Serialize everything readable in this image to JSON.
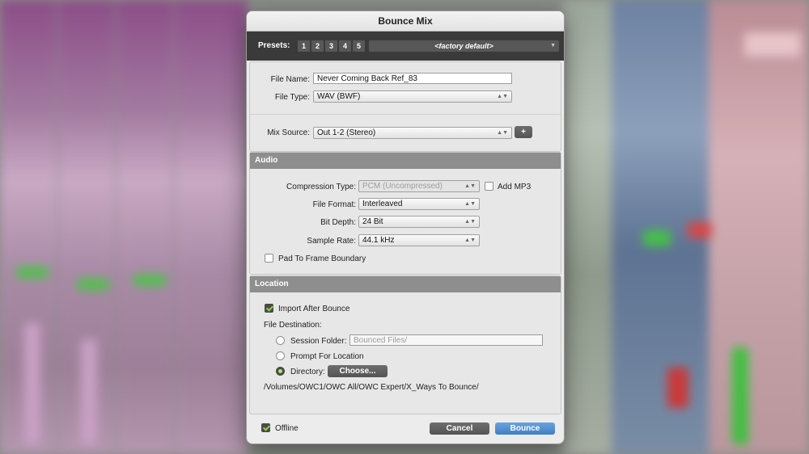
{
  "window": {
    "title": "Bounce Mix"
  },
  "presets": {
    "label": "Presets:",
    "slots": [
      "1",
      "2",
      "3",
      "4",
      "5"
    ],
    "selected": "<factory default>"
  },
  "file": {
    "name_label": "File Name:",
    "name_value": "Never Coming Back Ref_83",
    "type_label": "File Type:",
    "type_value": "WAV (BWF)",
    "mix_source_label": "Mix Source:",
    "mix_source_value": "Out 1-2 (Stereo)",
    "add_source_label": "+"
  },
  "audio": {
    "heading": "Audio",
    "compression_label": "Compression Type:",
    "compression_value": "PCM (Uncompressed)",
    "add_mp3_label": "Add MP3",
    "add_mp3_checked": false,
    "file_format_label": "File Format:",
    "file_format_value": "Interleaved",
    "bit_depth_label": "Bit Depth:",
    "bit_depth_value": "24 Bit",
    "sample_rate_label": "Sample Rate:",
    "sample_rate_value": "44.1 kHz",
    "pad_label": "Pad To Frame Boundary",
    "pad_checked": false
  },
  "location": {
    "heading": "Location",
    "import_label": "Import After Bounce",
    "import_checked": true,
    "destination_label": "File Destination:",
    "session_folder_label": "Session Folder:",
    "session_folder_value": "Bounced Files/",
    "prompt_label": "Prompt For Location",
    "directory_label": "Directory:",
    "choose_label": "Choose...",
    "selected_destination": "directory",
    "path": "/Volumes/OWC1/OWC All/OWC Expert/X_Ways To Bounce/"
  },
  "footer": {
    "offline_label": "Offline",
    "offline_checked": true,
    "cancel_label": "Cancel",
    "bounce_label": "Bounce"
  },
  "colors": {
    "accent": "#4a8ad0",
    "section_header": "#8e8e8e",
    "preset_bar": "#3a3a3a"
  }
}
